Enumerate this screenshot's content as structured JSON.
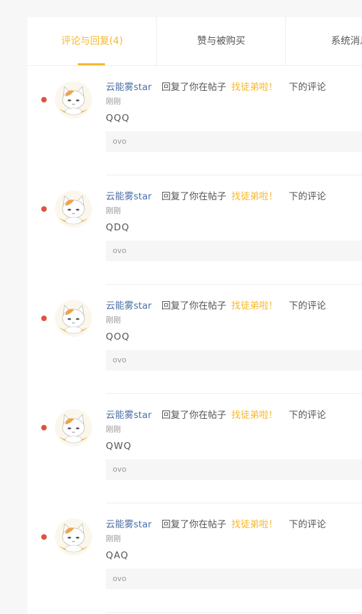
{
  "tabs": [
    {
      "label": "评论与回复(4)",
      "active": true
    },
    {
      "label": "赞与被购买",
      "active": false
    },
    {
      "label": "系统消息",
      "active": false
    }
  ],
  "colors": {
    "accent": "#f5b82e",
    "unread_dot": "#e0523e",
    "username": "#4a6fa5"
  },
  "notifications": [
    {
      "user": "云能雾star",
      "action": "回复了你在帖子",
      "post": "找徒弟啦！",
      "suffix": "下的评论",
      "time": "刚刚",
      "text": "QQQ",
      "quote": "ovo",
      "unread": true,
      "avatar_icon": "cat-avatar-icon"
    },
    {
      "user": "云能雾star",
      "action": "回复了你在帖子",
      "post": "找徒弟啦！",
      "suffix": "下的评论",
      "time": "刚刚",
      "text": "QDQ",
      "quote": "ovo",
      "unread": true,
      "avatar_icon": "cat-avatar-icon"
    },
    {
      "user": "云能雾star",
      "action": "回复了你在帖子",
      "post": "找徒弟啦！",
      "suffix": "下的评论",
      "time": "刚刚",
      "text": "QOQ",
      "quote": "ovo",
      "unread": true,
      "avatar_icon": "cat-avatar-icon"
    },
    {
      "user": "云能雾star",
      "action": "回复了你在帖子",
      "post": "找徒弟啦！",
      "suffix": "下的评论",
      "time": "刚刚",
      "text": "QWQ",
      "quote": "ovo",
      "unread": true,
      "avatar_icon": "cat-avatar-icon"
    },
    {
      "user": "云能雾star",
      "action": "回复了你在帖子",
      "post": "找徒弟啦！",
      "suffix": "下的评论",
      "time": "刚刚",
      "text": "QAQ",
      "quote": "ovo",
      "unread": true,
      "avatar_icon": "cat-avatar-icon"
    }
  ]
}
